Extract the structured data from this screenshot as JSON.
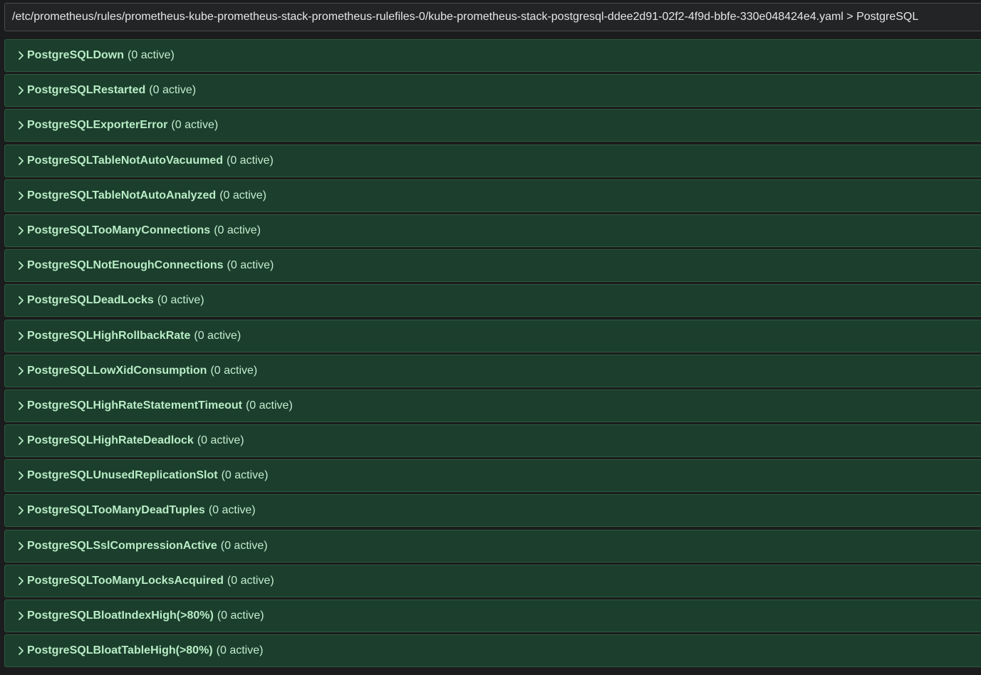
{
  "group": {
    "title": "/etc/prometheus/rules/prometheus-kube-prometheus-stack-prometheus-rulefiles-0/kube-prometheus-stack-postgresql-ddee2d91-02f2-4f9d-bbfe-330e048424e4.yaml > PostgreSQL"
  },
  "colors": {
    "rule_background": "#1c3e2c",
    "rule_border": "#2d5a3f",
    "rule_text": "#b8ecc6",
    "page_background": "#1b1c1d"
  },
  "rules": [
    {
      "name": "PostgreSQLDown",
      "count": "(0 active)",
      "icon": "chevron-right-icon"
    },
    {
      "name": "PostgreSQLRestarted",
      "count": "(0 active)",
      "icon": "chevron-right-icon"
    },
    {
      "name": "PostgreSQLExporterError",
      "count": "(0 active)",
      "icon": "chevron-right-icon"
    },
    {
      "name": "PostgreSQLTableNotAutoVacuumed",
      "count": "(0 active)",
      "icon": "chevron-right-icon"
    },
    {
      "name": "PostgreSQLTableNotAutoAnalyzed",
      "count": "(0 active)",
      "icon": "chevron-right-icon"
    },
    {
      "name": "PostgreSQLTooManyConnections",
      "count": "(0 active)",
      "icon": "chevron-right-icon"
    },
    {
      "name": "PostgreSQLNotEnoughConnections",
      "count": "(0 active)",
      "icon": "chevron-right-icon"
    },
    {
      "name": "PostgreSQLDeadLocks",
      "count": "(0 active)",
      "icon": "chevron-right-icon"
    },
    {
      "name": "PostgreSQLHighRollbackRate",
      "count": "(0 active)",
      "icon": "chevron-right-icon"
    },
    {
      "name": "PostgreSQLLowXidConsumption",
      "count": "(0 active)",
      "icon": "chevron-right-icon"
    },
    {
      "name": "PostgreSQLHighRateStatementTimeout",
      "count": "(0 active)",
      "icon": "chevron-right-icon"
    },
    {
      "name": "PostgreSQLHighRateDeadlock",
      "count": "(0 active)",
      "icon": "chevron-right-icon"
    },
    {
      "name": "PostgreSQLUnusedReplicationSlot",
      "count": "(0 active)",
      "icon": "chevron-right-icon"
    },
    {
      "name": "PostgreSQLTooManyDeadTuples",
      "count": "(0 active)",
      "icon": "chevron-right-icon"
    },
    {
      "name": "PostgreSQLSslCompressionActive",
      "count": "(0 active)",
      "icon": "chevron-right-icon"
    },
    {
      "name": "PostgreSQLTooManyLocksAcquired",
      "count": "(0 active)",
      "icon": "chevron-right-icon"
    },
    {
      "name": "PostgreSQLBloatIndexHigh(>80%)",
      "count": "(0 active)",
      "icon": "chevron-right-icon"
    },
    {
      "name": "PostgreSQLBloatTableHigh(>80%)",
      "count": "(0 active)",
      "icon": "chevron-right-icon"
    }
  ]
}
